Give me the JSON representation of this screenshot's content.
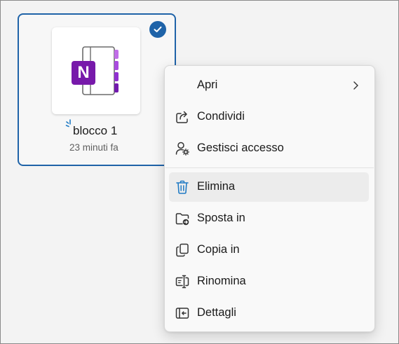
{
  "file": {
    "name": "blocco 1",
    "modified": "23 minuti fa",
    "app_letter": "N",
    "selected": true
  },
  "colors": {
    "selection": "#1f63a8",
    "onenote_purple": "#7719aa",
    "tab_lilac": "#c16ee8",
    "tab_purple": "#9e3cd9",
    "tab_dark": "#7a1ab5",
    "accent_blue": "#1f7ac4"
  },
  "menu": {
    "items": [
      {
        "label": "Apri",
        "icon": "none",
        "has_submenu": true
      },
      {
        "label": "Condividi",
        "icon": "share-icon"
      },
      {
        "label": "Gestisci accesso",
        "icon": "manage-access-icon"
      },
      {
        "label": "Elimina",
        "icon": "trash-icon",
        "highlighted": true
      },
      {
        "label": "Sposta in",
        "icon": "move-to-folder-icon"
      },
      {
        "label": "Copia in",
        "icon": "copy-icon"
      },
      {
        "label": "Rinomina",
        "icon": "rename-icon"
      },
      {
        "label": "Dettagli",
        "icon": "details-pane-icon"
      }
    ]
  }
}
